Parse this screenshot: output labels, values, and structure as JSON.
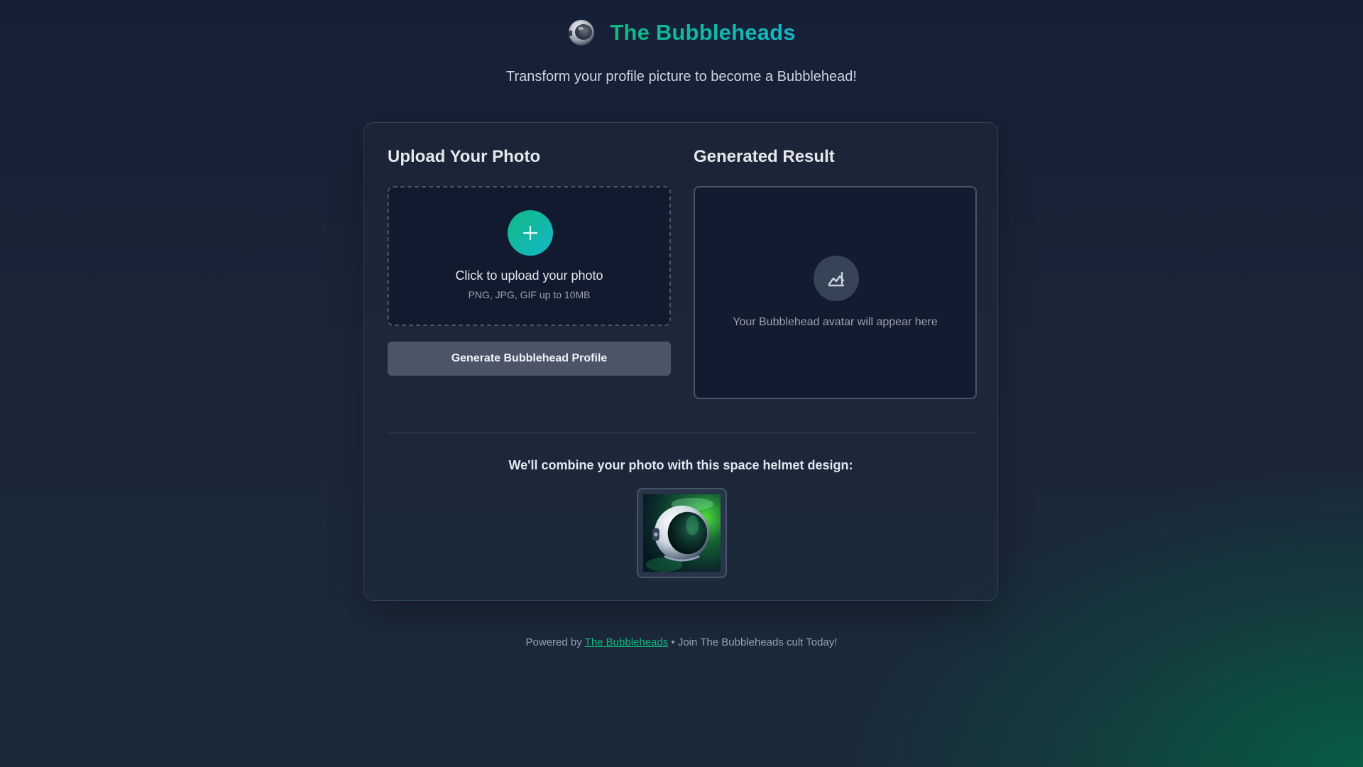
{
  "header": {
    "logo_icon": "astronaut-helmet-icon",
    "title": "The Bubbleheads",
    "subtitle": "Transform your profile picture to become a Bubblehead!"
  },
  "upload": {
    "title": "Upload Your Photo",
    "icon": "plus-icon",
    "label": "Click to upload your photo",
    "hint": "PNG, JPG, GIF up to 10MB",
    "button_label": "Generate Bubblehead Profile"
  },
  "result": {
    "title": "Generated Result",
    "icon": "image-placeholder-icon",
    "placeholder_text": "Your Bubblehead avatar will appear here"
  },
  "helmet": {
    "caption": "We'll combine your photo with this space helmet design:",
    "image_icon": "space-helmet-image"
  },
  "footer": {
    "prefix": "Powered by",
    "link_text": "The Bubbleheads",
    "suffix": "• Join The Bubbleheads cult Today!"
  },
  "colors": {
    "accent_green": "#10b981",
    "accent_teal": "#14b8c8",
    "background": "#151f36",
    "button": "#4b5567"
  }
}
